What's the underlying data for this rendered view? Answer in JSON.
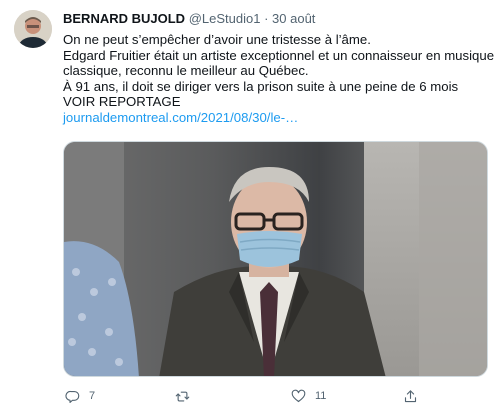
{
  "tweet": {
    "author_name": "BERNARD BUJOLD",
    "handle": "@LeStudio1",
    "separator": "·",
    "date": "30 août",
    "lines": [
      "On ne peut s’empêcher d’avoir une tristesse à l’âme.",
      "Edgard Fruitier était un artiste exceptionnel et un connaisseur en musique",
      "classique, reconnu le meilleur au Québec.",
      "À 91 ans, il doit se diriger vers la prison suite à une peine de 6 mois",
      "VOIR REPORTAGE"
    ],
    "link": "journaldemontreal.com/2021/08/30/le-…"
  },
  "actions": {
    "reply_count": "7",
    "retweet_count": "",
    "like_count": "11"
  },
  "icons": {
    "reply": "reply-icon",
    "retweet": "retweet-icon",
    "like": "heart-icon",
    "share": "share-icon"
  },
  "colors": {
    "link": "#1d9bf0",
    "secondary_text": "#536471",
    "primary_text": "#0f1419"
  }
}
